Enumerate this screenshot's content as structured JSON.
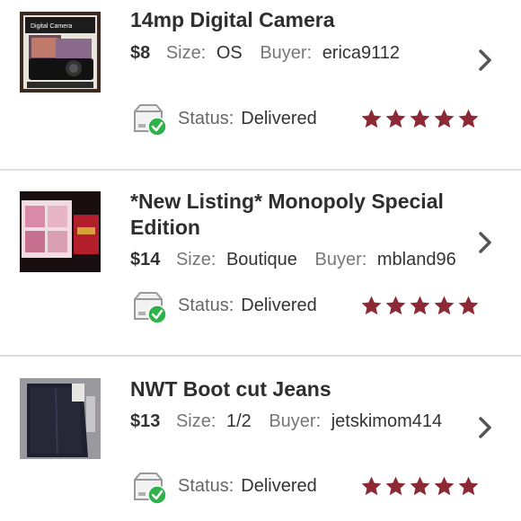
{
  "sales": [
    {
      "title": "14mp Digital Camera",
      "price": "$8",
      "size_label": "Size:",
      "size": "OS",
      "buyer_label": "Buyer:",
      "buyer": "erica9112",
      "status_label": "Status:",
      "status": "Delivered",
      "rating": 5,
      "thumb_text": "Digital Camera"
    },
    {
      "title": "*New Listing* Monopoly Special Edition",
      "price": "$14",
      "size_label": "Size:",
      "size": "Boutique",
      "buyer_label": "Buyer:",
      "buyer": "mbland96",
      "status_label": "Status:",
      "status": "Delivered",
      "rating": 5
    },
    {
      "title": "NWT Boot cut Jeans",
      "price": "$13",
      "size_label": "Size:",
      "size": "1/2",
      "buyer_label": "Buyer:",
      "buyer": "jetskimom414",
      "status_label": "Status:",
      "status": "Delivered",
      "rating": 5
    }
  ],
  "colors": {
    "star": "#8b2a35",
    "status_check": "#2fb24a",
    "chevron": "#555555"
  }
}
